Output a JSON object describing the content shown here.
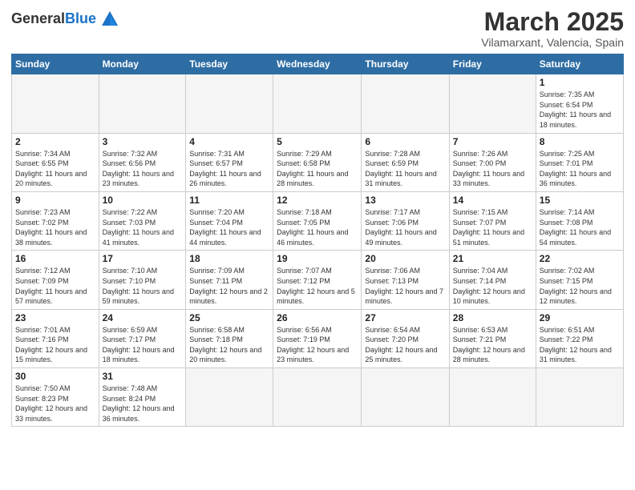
{
  "header": {
    "logo_general": "General",
    "logo_blue": "Blue",
    "title": "March 2025",
    "location": "Vilamarxant, Valencia, Spain"
  },
  "weekdays": [
    "Sunday",
    "Monday",
    "Tuesday",
    "Wednesday",
    "Thursday",
    "Friday",
    "Saturday"
  ],
  "rows": [
    [
      {
        "day": "",
        "info": ""
      },
      {
        "day": "",
        "info": ""
      },
      {
        "day": "",
        "info": ""
      },
      {
        "day": "",
        "info": ""
      },
      {
        "day": "",
        "info": ""
      },
      {
        "day": "",
        "info": ""
      },
      {
        "day": "1",
        "info": "Sunrise: 7:35 AM\nSunset: 6:54 PM\nDaylight: 11 hours and 18 minutes."
      }
    ],
    [
      {
        "day": "2",
        "info": "Sunrise: 7:34 AM\nSunset: 6:55 PM\nDaylight: 11 hours and 20 minutes."
      },
      {
        "day": "3",
        "info": "Sunrise: 7:32 AM\nSunset: 6:56 PM\nDaylight: 11 hours and 23 minutes."
      },
      {
        "day": "4",
        "info": "Sunrise: 7:31 AM\nSunset: 6:57 PM\nDaylight: 11 hours and 26 minutes."
      },
      {
        "day": "5",
        "info": "Sunrise: 7:29 AM\nSunset: 6:58 PM\nDaylight: 11 hours and 28 minutes."
      },
      {
        "day": "6",
        "info": "Sunrise: 7:28 AM\nSunset: 6:59 PM\nDaylight: 11 hours and 31 minutes."
      },
      {
        "day": "7",
        "info": "Sunrise: 7:26 AM\nSunset: 7:00 PM\nDaylight: 11 hours and 33 minutes."
      },
      {
        "day": "8",
        "info": "Sunrise: 7:25 AM\nSunset: 7:01 PM\nDaylight: 11 hours and 36 minutes."
      }
    ],
    [
      {
        "day": "9",
        "info": "Sunrise: 7:23 AM\nSunset: 7:02 PM\nDaylight: 11 hours and 38 minutes."
      },
      {
        "day": "10",
        "info": "Sunrise: 7:22 AM\nSunset: 7:03 PM\nDaylight: 11 hours and 41 minutes."
      },
      {
        "day": "11",
        "info": "Sunrise: 7:20 AM\nSunset: 7:04 PM\nDaylight: 11 hours and 44 minutes."
      },
      {
        "day": "12",
        "info": "Sunrise: 7:18 AM\nSunset: 7:05 PM\nDaylight: 11 hours and 46 minutes."
      },
      {
        "day": "13",
        "info": "Sunrise: 7:17 AM\nSunset: 7:06 PM\nDaylight: 11 hours and 49 minutes."
      },
      {
        "day": "14",
        "info": "Sunrise: 7:15 AM\nSunset: 7:07 PM\nDaylight: 11 hours and 51 minutes."
      },
      {
        "day": "15",
        "info": "Sunrise: 7:14 AM\nSunset: 7:08 PM\nDaylight: 11 hours and 54 minutes."
      }
    ],
    [
      {
        "day": "16",
        "info": "Sunrise: 7:12 AM\nSunset: 7:09 PM\nDaylight: 11 hours and 57 minutes."
      },
      {
        "day": "17",
        "info": "Sunrise: 7:10 AM\nSunset: 7:10 PM\nDaylight: 11 hours and 59 minutes."
      },
      {
        "day": "18",
        "info": "Sunrise: 7:09 AM\nSunset: 7:11 PM\nDaylight: 12 hours and 2 minutes."
      },
      {
        "day": "19",
        "info": "Sunrise: 7:07 AM\nSunset: 7:12 PM\nDaylight: 12 hours and 5 minutes."
      },
      {
        "day": "20",
        "info": "Sunrise: 7:06 AM\nSunset: 7:13 PM\nDaylight: 12 hours and 7 minutes."
      },
      {
        "day": "21",
        "info": "Sunrise: 7:04 AM\nSunset: 7:14 PM\nDaylight: 12 hours and 10 minutes."
      },
      {
        "day": "22",
        "info": "Sunrise: 7:02 AM\nSunset: 7:15 PM\nDaylight: 12 hours and 12 minutes."
      }
    ],
    [
      {
        "day": "23",
        "info": "Sunrise: 7:01 AM\nSunset: 7:16 PM\nDaylight: 12 hours and 15 minutes."
      },
      {
        "day": "24",
        "info": "Sunrise: 6:59 AM\nSunset: 7:17 PM\nDaylight: 12 hours and 18 minutes."
      },
      {
        "day": "25",
        "info": "Sunrise: 6:58 AM\nSunset: 7:18 PM\nDaylight: 12 hours and 20 minutes."
      },
      {
        "day": "26",
        "info": "Sunrise: 6:56 AM\nSunset: 7:19 PM\nDaylight: 12 hours and 23 minutes."
      },
      {
        "day": "27",
        "info": "Sunrise: 6:54 AM\nSunset: 7:20 PM\nDaylight: 12 hours and 25 minutes."
      },
      {
        "day": "28",
        "info": "Sunrise: 6:53 AM\nSunset: 7:21 PM\nDaylight: 12 hours and 28 minutes."
      },
      {
        "day": "29",
        "info": "Sunrise: 6:51 AM\nSunset: 7:22 PM\nDaylight: 12 hours and 31 minutes."
      }
    ],
    [
      {
        "day": "30",
        "info": "Sunrise: 7:50 AM\nSunset: 8:23 PM\nDaylight: 12 hours and 33 minutes."
      },
      {
        "day": "31",
        "info": "Sunrise: 7:48 AM\nSunset: 8:24 PM\nDaylight: 12 hours and 36 minutes."
      },
      {
        "day": "",
        "info": ""
      },
      {
        "day": "",
        "info": ""
      },
      {
        "day": "",
        "info": ""
      },
      {
        "day": "",
        "info": ""
      },
      {
        "day": "",
        "info": ""
      }
    ]
  ]
}
